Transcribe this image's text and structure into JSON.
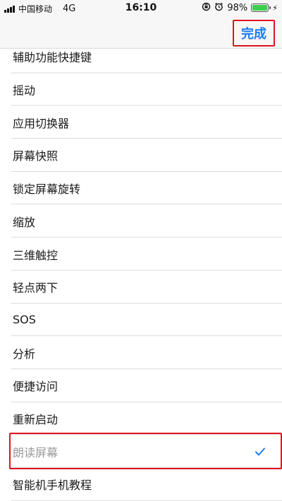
{
  "status_bar": {
    "carrier": "中国移动",
    "network": "4G",
    "time": "16:10",
    "battery_percent": "98%",
    "battery_level": 0.98,
    "icons": [
      "signal-icon",
      "rotation-lock-icon",
      "alarm-icon",
      "battery-icon",
      "charging-icon"
    ]
  },
  "navbar": {
    "done_label": "完成",
    "accent_color": "#1b7cf0",
    "highlight_color": "#e0141e"
  },
  "list": {
    "items": [
      {
        "label": "辅助功能快捷键"
      },
      {
        "label": "摇动"
      },
      {
        "label": "应用切换器"
      },
      {
        "label": "屏幕快照"
      },
      {
        "label": "锁定屏幕旋转"
      },
      {
        "label": "缩放"
      },
      {
        "label": "三维触控"
      },
      {
        "label": "轻点两下"
      },
      {
        "label": "SOS"
      },
      {
        "label": "分析"
      },
      {
        "label": "便捷访问"
      },
      {
        "label": "重新启动"
      },
      {
        "label": "朗读屏幕",
        "selected": true
      },
      {
        "label": "智能机手机教程"
      }
    ]
  }
}
